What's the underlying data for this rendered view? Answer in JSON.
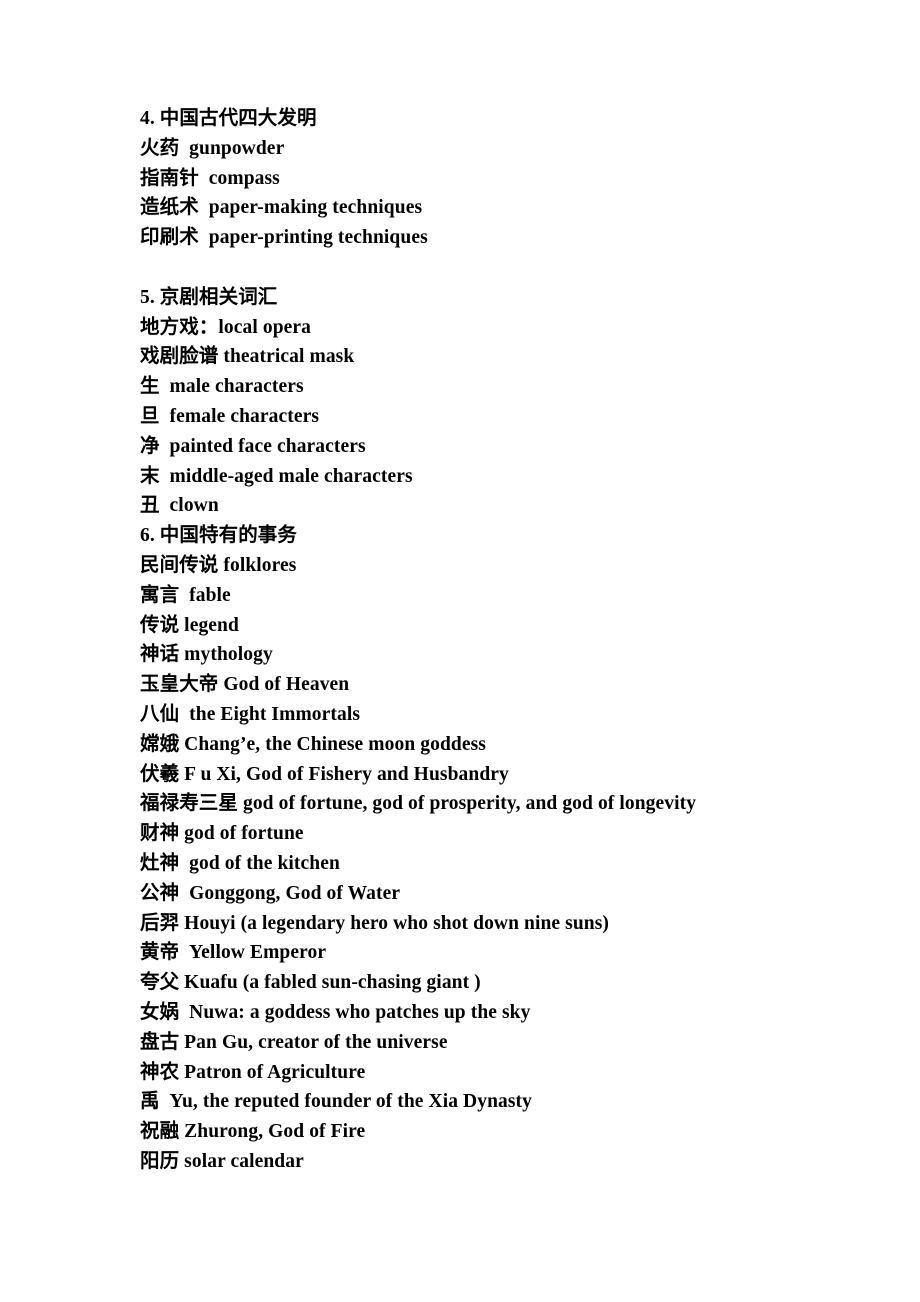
{
  "document": {
    "sections": [
      {
        "id": "section-4",
        "heading": "4. 中国古代四大发明",
        "spacer_after": true,
        "entries": [
          "火药  gunpowder",
          "指南针  compass",
          "造纸术  paper-making techniques",
          "印刷术  paper-printing techniques"
        ]
      },
      {
        "id": "section-5",
        "heading": "5. 京剧相关词汇",
        "spacer_after": false,
        "entries": [
          "地方戏：local opera",
          "戏剧脸谱 theatrical mask",
          "生  male characters",
          "旦  female characters",
          "净  painted face characters",
          "末  middle-aged male characters",
          "丑  clown"
        ]
      },
      {
        "id": "section-6",
        "heading": "6. 中国特有的事务",
        "spacer_after": false,
        "entries": [
          "民间传说 folklores",
          "寓言  fable",
          "传说 legend",
          "神话 mythology",
          "玉皇大帝 God of Heaven",
          "八仙  the Eight Immortals",
          "嫦娥 Chang’e, the Chinese moon goddess",
          "伏羲 F u Xi, God of Fishery and Husbandry",
          "福禄寿三星 god of fortune, god of prosperity, and god of longevity",
          "财神 god of fortune",
          "灶神  god of the kitchen",
          "公神  Gonggong, God of Water",
          "后羿 Houyi (a legendary hero who shot down nine suns)",
          "黄帝  Yellow Emperor",
          "夸父 Kuafu (a fabled sun-chasing giant )",
          "女娲  Nuwa: a goddess who patches up the sky",
          "盘古 Pan Gu, creator of the universe",
          "神农 Patron of Agriculture",
          "禹  Yu, the reputed founder of the Xia Dynasty",
          "祝融 Zhurong, God of Fire",
          "阳历 solar calendar"
        ]
      }
    ]
  },
  "style": {
    "text_color": "#000000",
    "background_color": "#ffffff"
  }
}
